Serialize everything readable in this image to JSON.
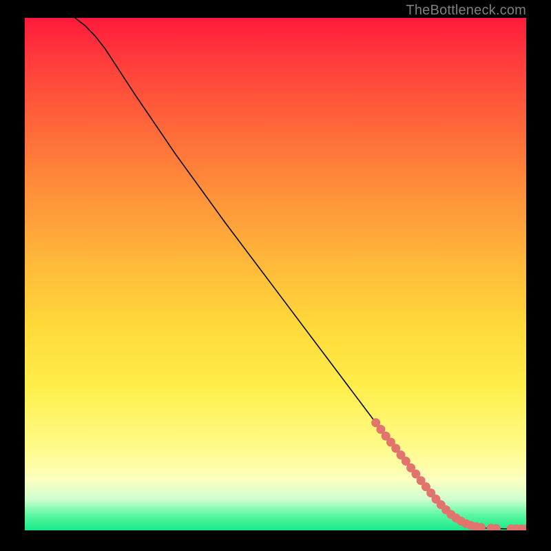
{
  "attribution": "TheBottleneck.com",
  "chart_data": {
    "type": "line",
    "title": "",
    "xlabel": "",
    "ylabel": "",
    "xlim": [
      0,
      100
    ],
    "ylim": [
      0,
      100
    ],
    "curve": {
      "x": [
        10,
        12,
        14,
        16,
        18,
        22,
        30,
        40,
        50,
        60,
        70,
        76,
        80,
        84,
        86,
        88,
        90,
        92,
        94,
        96,
        98,
        100
      ],
      "y": [
        100,
        98.5,
        96.5,
        94.0,
        91.0,
        85.0,
        73.5,
        60.0,
        47.0,
        34.0,
        21.0,
        13.5,
        8.5,
        4.0,
        2.4,
        1.3,
        0.7,
        0.45,
        0.35,
        0.3,
        0.28,
        0.27
      ]
    },
    "markers": {
      "x": [
        70,
        71,
        72,
        73,
        74,
        75,
        76,
        77,
        78,
        79,
        80,
        81,
        82,
        83,
        84,
        85,
        86,
        87,
        88,
        89,
        90,
        91,
        93,
        94,
        97,
        98,
        99,
        100
      ],
      "y": [
        21.0,
        19.7,
        18.4,
        17.2,
        16.0,
        14.7,
        13.5,
        12.2,
        11.0,
        9.7,
        8.5,
        7.3,
        6.1,
        5.0,
        4.0,
        3.1,
        2.4,
        1.8,
        1.3,
        0.95,
        0.7,
        0.55,
        0.4,
        0.35,
        0.29,
        0.28,
        0.275,
        0.27
      ]
    },
    "colors": {
      "curve": "#000000",
      "marker": "#e2746e",
      "gradient_top": "#ff1a3c",
      "gradient_mid": "#ffee4a",
      "gradient_bottom": "#17e98a",
      "background": "#000000",
      "attribution": "#7f7f7f"
    }
  }
}
